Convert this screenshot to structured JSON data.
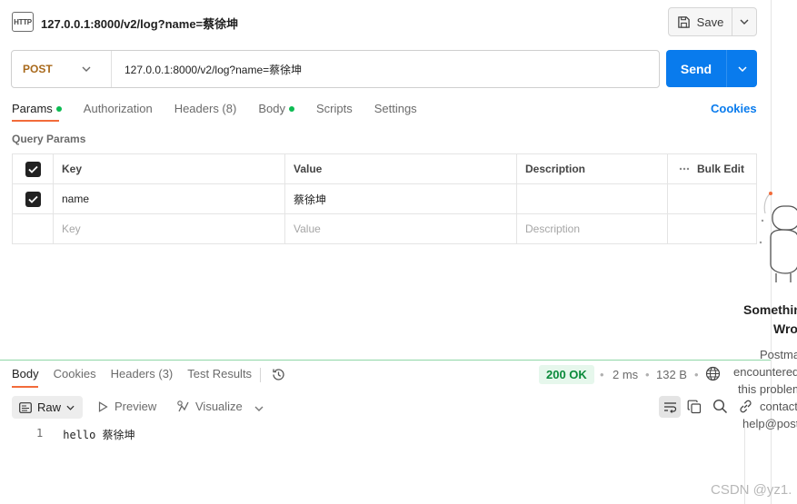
{
  "tab": {
    "icon": "http-icon",
    "title": "127.0.0.1:8000/v2/log?name=蔡徐坤"
  },
  "toolbar": {
    "save_label": "Save"
  },
  "request": {
    "method": "POST",
    "url": "127.0.0.1:8000/v2/log?name=蔡徐坤",
    "send_label": "Send"
  },
  "request_tabs": {
    "params": "Params",
    "authorization": "Authorization",
    "headers": "Headers (8)",
    "body": "Body",
    "scripts": "Scripts",
    "settings": "Settings",
    "cookies": "Cookies"
  },
  "query_params": {
    "title": "Query Params",
    "columns": {
      "key": "Key",
      "value": "Value",
      "description": "Description",
      "bulk_edit": "Bulk Edit"
    },
    "rows": [
      {
        "checked": true,
        "key": "name",
        "value": "蔡徐坤",
        "description": ""
      }
    ],
    "placeholder": {
      "key": "Key",
      "value": "Value",
      "description": "Description"
    }
  },
  "response_tabs": {
    "body": "Body",
    "cookies": "Cookies",
    "headers": "Headers (3)",
    "test_results": "Test Results"
  },
  "response_meta": {
    "status": "200 OK",
    "time": "2 ms",
    "size": "132 B",
    "sep": "•"
  },
  "response_toolbar": {
    "raw": "Raw",
    "preview": "Preview",
    "visualize": "Visualize"
  },
  "response_body": {
    "line_number": "1",
    "content": "hello 蔡徐坤"
  },
  "side_panel": {
    "title_line1": "Somethin",
    "title_line2": "Wro",
    "lines": [
      "Postma",
      "encountered",
      "this problem",
      "contact",
      "help@post"
    ]
  },
  "watermark": "CSDN @yz1.",
  "colors": {
    "accent": "#097bed",
    "tab_indicator": "#f26b3a",
    "status_ok": "#0a8a3a",
    "method_post": "#a8691b"
  }
}
